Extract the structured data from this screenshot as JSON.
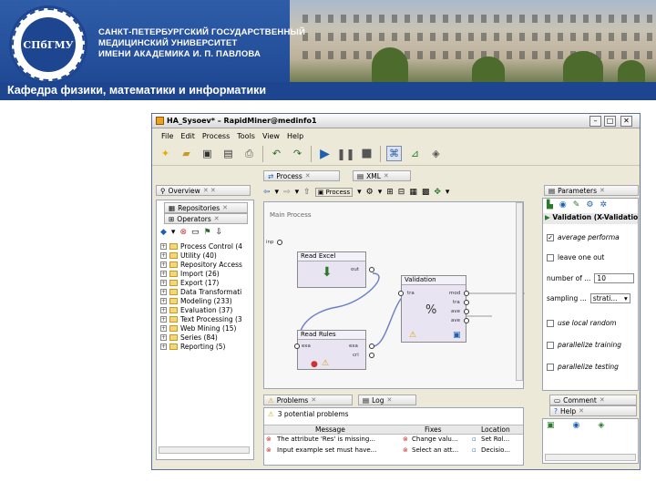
{
  "banner": {
    "university_line1": "САНКТ-ПЕТЕРБУРГСКИЙ ГОСУДАРСТВЕННЫЙ",
    "university_line2": "МЕДИЦИНСКИЙ УНИВЕРСИТЕТ",
    "university_line3": "ИМЕНИ АКАДЕМИКА И. П. ПАВЛОВА",
    "department": "Кафедра физики, математики и информатики",
    "logo_text": "СПбГМУ",
    "logo_ring_text": "MEDICINAE ARS NOBILISSIMA",
    "logo_year": "1897",
    "brand_color": "#1d4590"
  },
  "app": {
    "title": "HA_Sysoev* – RapidMiner@medinfo1",
    "menu": [
      "File",
      "Edit",
      "Process",
      "Tools",
      "View",
      "Help"
    ],
    "toolbar_icons": [
      "new-icon",
      "open-icon",
      "save-icon",
      "save-as-icon",
      "print-icon",
      "undo-icon",
      "redo-icon",
      "run-icon",
      "pause-icon",
      "stop-icon",
      "perspective-design-icon",
      "perspective-result-icon",
      "perspective-welcome-icon"
    ],
    "left_tabs": {
      "overview": "Overview",
      "repositories": "Repositories",
      "operators": "Operators"
    },
    "operator_tree": [
      "Process Control (4",
      "Utility (40)",
      "Repository Access",
      "Import (26)",
      "Export (17)",
      "Data Transformati",
      "Modeling (233)",
      "Evaluation (37)",
      "Text Processing (3",
      "Web Mining (15)",
      "Series (84)",
      "Reporting (5)"
    ],
    "process_tabs": {
      "process": "Process",
      "xml": "XML"
    },
    "breadcrumb": "Process",
    "canvas_title": "Main Process",
    "operators": {
      "read_excel": {
        "name": "Read Excel",
        "port_out": "out"
      },
      "read_rules": {
        "name": "Read Rules",
        "ports_in": [
          "exa",
          "exa"
        ],
        "ports_out": [
          "exa",
          "cri"
        ]
      },
      "validation": {
        "name": "Validation",
        "port_in": "tra",
        "ports_out": [
          "mod",
          "tra",
          "ave",
          "ave"
        ]
      }
    },
    "canvas_port_label": "inp",
    "parameters": {
      "tab": "Parameters",
      "header": "Validation (X-Validation)",
      "rows": [
        {
          "type": "checkbox",
          "label": "average performa",
          "checked": true
        },
        {
          "type": "checkbox",
          "label": "leave one out",
          "checked": false
        },
        {
          "type": "field",
          "label": "number of ...",
          "value": "10"
        },
        {
          "type": "select",
          "label": "sampling ...",
          "value": "strati..."
        },
        {
          "type": "checkbox",
          "label": "use local random",
          "checked": false
        },
        {
          "type": "checkbox",
          "label": "parallelize training",
          "checked": false
        },
        {
          "type": "checkbox",
          "label": "parallelize testing",
          "checked": false
        }
      ]
    },
    "comment_tab": "Comment",
    "help_tab": "Help",
    "problems": {
      "tab": "Problems",
      "log_tab": "Log",
      "summary": "3 potential problems",
      "columns": [
        "Message",
        "Fixes",
        "Location"
      ],
      "rows": [
        {
          "message": "The attribute 'Res' is missing...",
          "fix": "Change valu...",
          "location": "Set Rol..."
        },
        {
          "message": "Input example set must have...",
          "fix": "Select an att...",
          "location": "Decisio..."
        }
      ]
    }
  }
}
